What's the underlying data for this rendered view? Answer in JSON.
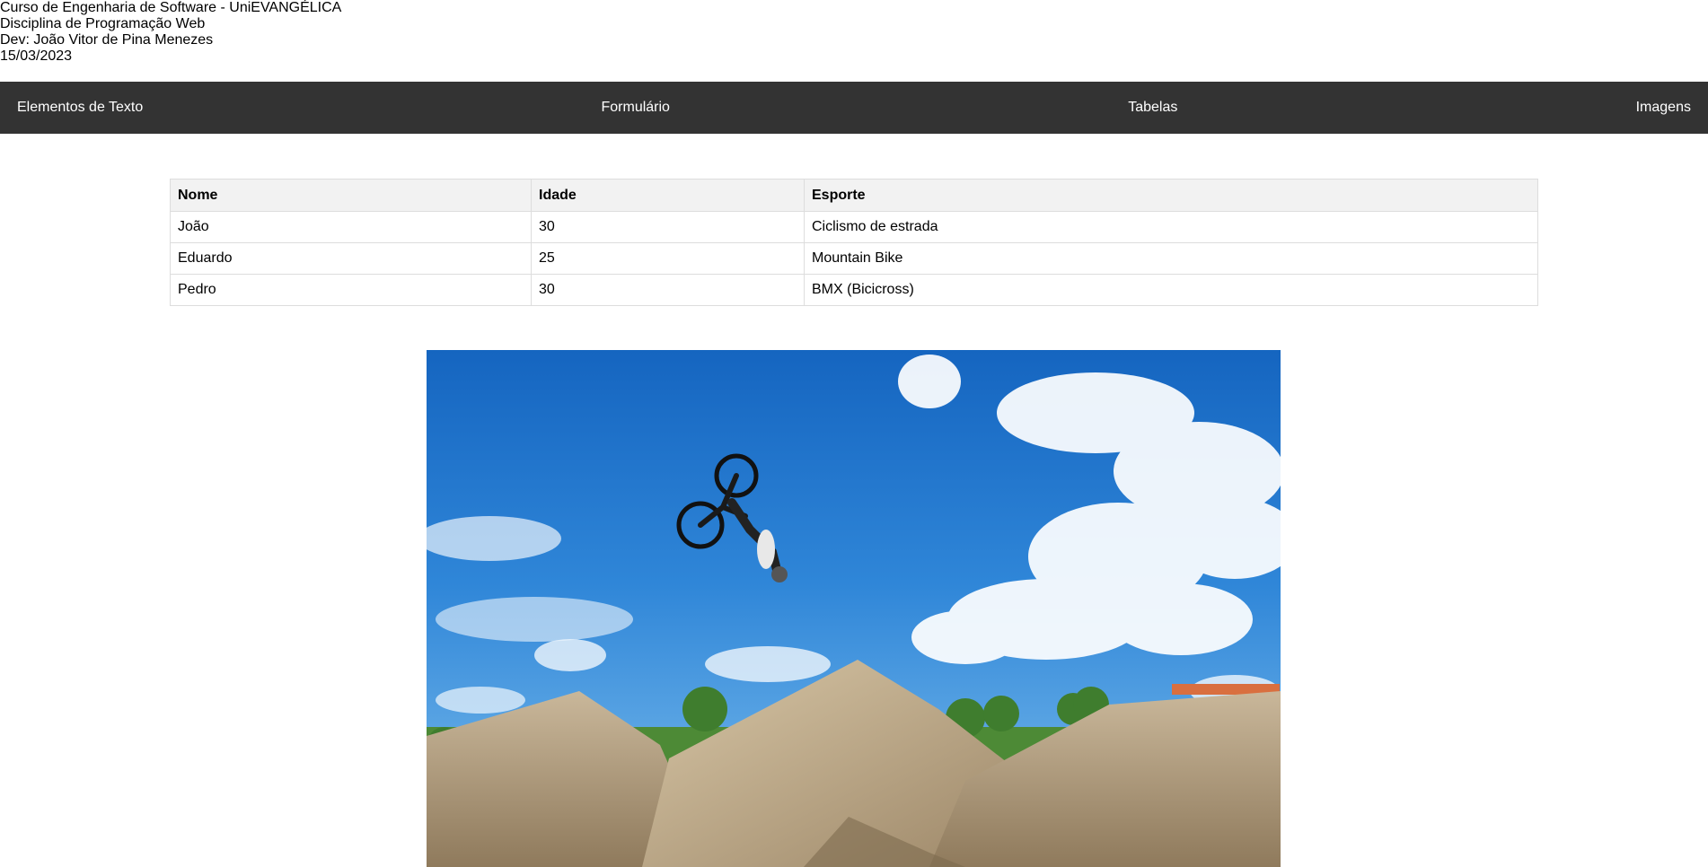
{
  "header": {
    "lines": [
      "Curso de Engenharia de Software - UniEVANGÉLICA",
      "Disciplina de Programação Web",
      "Dev: João Vitor de Pina Menezes",
      "15/03/2023"
    ]
  },
  "nav": {
    "items": [
      {
        "label": "Elementos de Texto"
      },
      {
        "label": "Formulário"
      },
      {
        "label": "Tabelas"
      },
      {
        "label": "Imagens"
      }
    ]
  },
  "table": {
    "headers": [
      "Nome",
      "Idade",
      "Esporte"
    ],
    "rows": [
      [
        "João",
        "30",
        "Ciclismo de estrada"
      ],
      [
        "Eduardo",
        "25",
        "Mountain Bike"
      ],
      [
        "Pedro",
        "30",
        "BMX (Bicicross)"
      ]
    ]
  },
  "colors": {
    "navbar": "#333333",
    "nav_text": "#ffffff",
    "table_header_bg": "#f2f2f2",
    "table_border": "#dddddd"
  }
}
